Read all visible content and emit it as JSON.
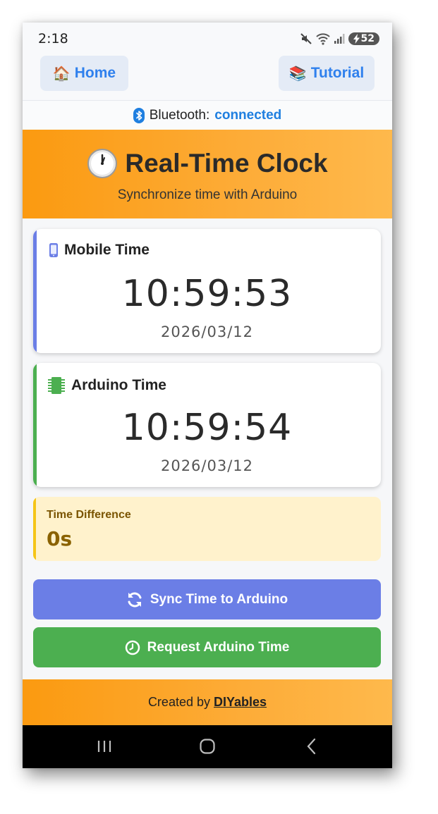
{
  "status_bar": {
    "time": "2:18",
    "battery": "52"
  },
  "nav": {
    "home": {
      "emoji": "🏠",
      "label": "Home"
    },
    "tutorial": {
      "emoji": "📚",
      "label": "Tutorial"
    }
  },
  "bluetooth": {
    "label": "Bluetooth:",
    "status": "connected"
  },
  "header": {
    "emoji": "🕐",
    "title": "Real-Time Clock",
    "subtitle": "Synchronize time with Arduino"
  },
  "mobile": {
    "title": "Mobile Time",
    "time": "10:59:53",
    "date": "2026/03/12"
  },
  "arduino": {
    "title": "Arduino Time",
    "time": "10:59:54",
    "date": "2026/03/12"
  },
  "difference": {
    "label": "Time Difference",
    "value": "0s"
  },
  "buttons": {
    "sync": "Sync Time to Arduino",
    "request": "Request Arduino Time"
  },
  "footer": {
    "prefix": "Created by",
    "link": "DIYables"
  },
  "colors": {
    "accent_orange": "#fb9a10",
    "mobile_stripe": "#6b7ee6",
    "arduino_stripe": "#4caf50",
    "sync_button": "#6b7ee6",
    "request_button": "#4caf50",
    "link_blue": "#2f80ed"
  }
}
